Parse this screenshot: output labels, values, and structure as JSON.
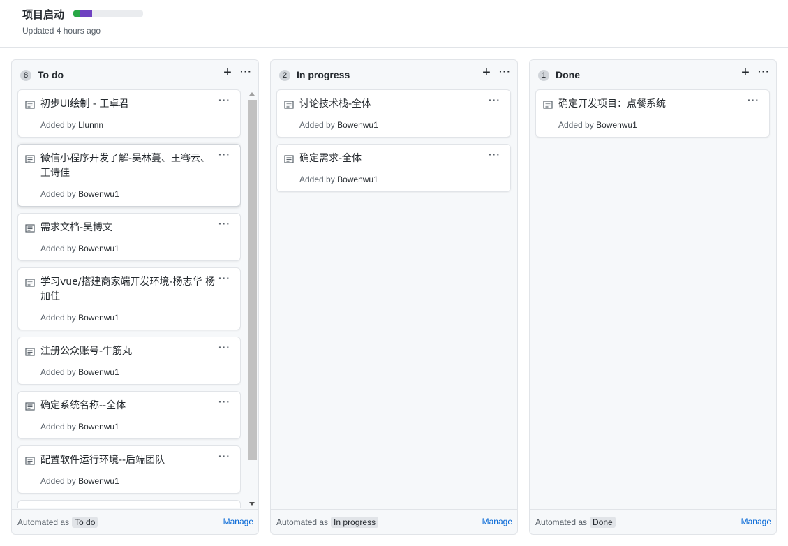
{
  "project": {
    "title": "项目启动",
    "updated": "Updated 4 hours ago",
    "progress": [
      {
        "color": "#28a745",
        "fraction": 0.09
      },
      {
        "color": "#6f42c1",
        "fraction": 0.18
      }
    ]
  },
  "icons": {
    "card": "note-icon",
    "add": "plus-icon",
    "menu": "kebab-menu-icon"
  },
  "columns": [
    {
      "name": "To do",
      "count": "8",
      "cards": [
        {
          "title": "初步UI绘制 - 王卓君",
          "added_by": "Added by",
          "user": "Llunnn"
        },
        {
          "title": "微信小程序开发了解-吴林蔓、王骞云、王诗佳",
          "added_by": "Added by",
          "user": "Bowenwu1"
        },
        {
          "title": "需求文档-吴博文",
          "added_by": "Added by",
          "user": "Bowenwu1"
        },
        {
          "title": "学习vue/搭建商家端开发环境-杨志华 杨加佳",
          "added_by": "Added by",
          "user": "Bowenwu1"
        },
        {
          "title": "注册公众账号-牛筋丸",
          "added_by": "Added by",
          "user": "Bowenwu1"
        },
        {
          "title": "确定系统名称--全体",
          "added_by": "Added by",
          "user": "Bowenwu1"
        },
        {
          "title": "配置软件运行环境--后端团队",
          "added_by": "Added by",
          "user": "Bowenwu1"
        }
      ],
      "footer": {
        "label": "Automated as",
        "chip": "To do",
        "manage": "Manage"
      }
    },
    {
      "name": "In progress",
      "count": "2",
      "cards": [
        {
          "title": "讨论技术栈-全体",
          "added_by": "Added by",
          "user": "Bowenwu1"
        },
        {
          "title": "确定需求-全体",
          "added_by": "Added by",
          "user": "Bowenwu1"
        }
      ],
      "footer": {
        "label": "Automated as",
        "chip": "In progress",
        "manage": "Manage"
      }
    },
    {
      "name": "Done",
      "count": "1",
      "cards": [
        {
          "title": "确定开发项目：点餐系统",
          "added_by": "Added by",
          "user": "Bowenwu1"
        }
      ],
      "footer": {
        "label": "Automated as",
        "chip": "Done",
        "manage": "Manage"
      }
    }
  ]
}
